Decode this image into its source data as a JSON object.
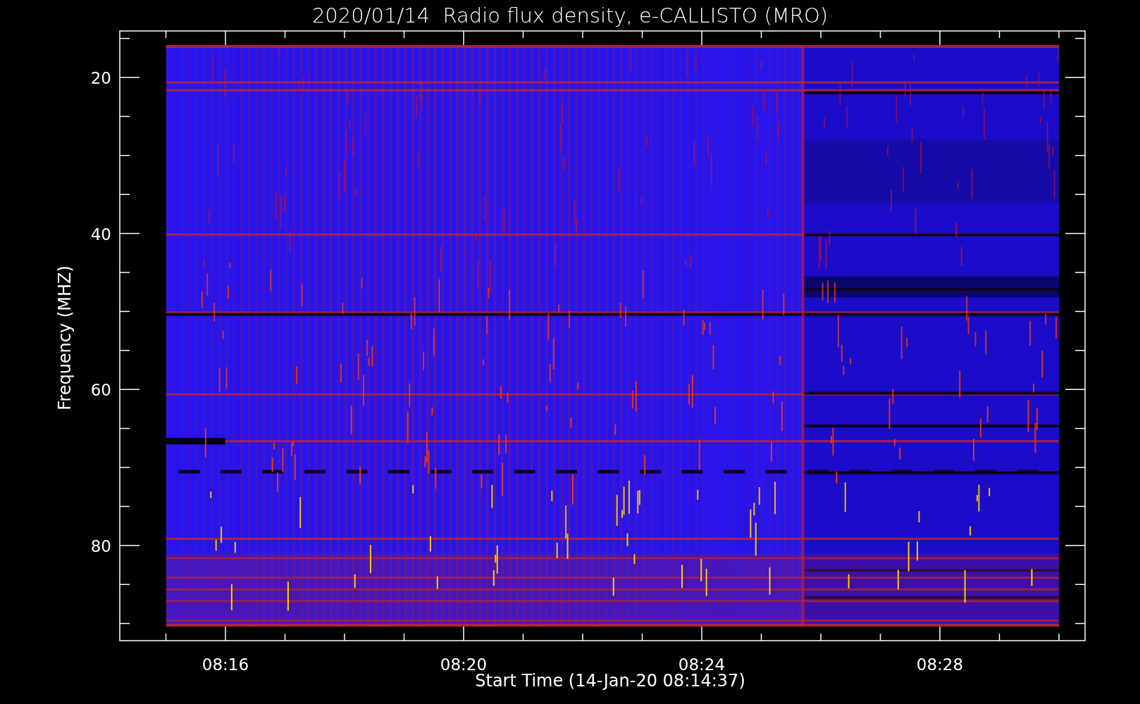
{
  "title": "2020/01/14  Radio flux density, e-CALLISTO (MRO)",
  "y_axis": {
    "label": "Frequency (MHZ)",
    "tick_labels": [
      "20",
      "40",
      "60",
      "80"
    ]
  },
  "x_axis": {
    "label": "Start Time (14-Jan-20 08:14:37)",
    "tick_labels": [
      "08:16",
      "08:20",
      "08:24",
      "08:28"
    ]
  }
}
